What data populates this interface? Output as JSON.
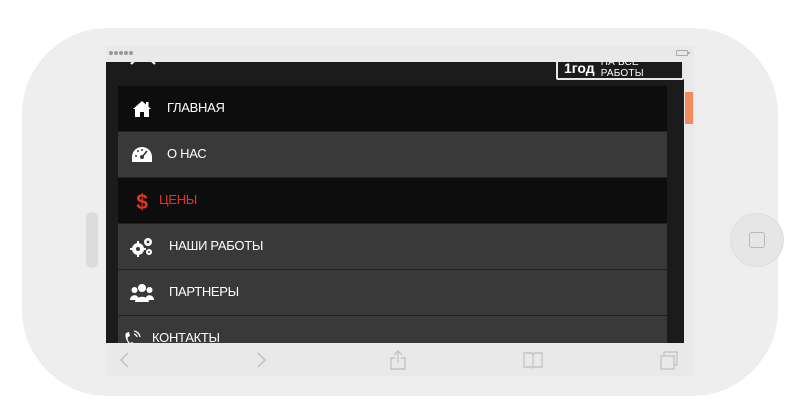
{
  "promo": {
    "big": "1год",
    "small": "НА ВСЕ РАБОТЫ"
  },
  "menu": {
    "items": [
      {
        "label": "ГЛАВНАЯ",
        "icon": "home-icon"
      },
      {
        "label": "О НАС",
        "icon": "dashboard-icon"
      },
      {
        "label": "ЦЕНЫ",
        "icon": "dollar-icon"
      },
      {
        "label": "НАШИ РАБОТЫ",
        "icon": "gears-icon"
      },
      {
        "label": "ПАРТНЕРЫ",
        "icon": "users-icon"
      },
      {
        "label": "КОНТАКТЫ",
        "icon": "phone-icon"
      }
    ],
    "active_index": 2
  },
  "colors": {
    "active_label": "#e2361f",
    "scroll_thumb": "#f28a5e",
    "menu_dark": "#0d0d0d",
    "menu_light": "#393939"
  },
  "browser_toolbar": {
    "icons": [
      "back-icon",
      "forward-icon",
      "share-icon",
      "bookmarks-icon",
      "tabs-icon"
    ]
  }
}
